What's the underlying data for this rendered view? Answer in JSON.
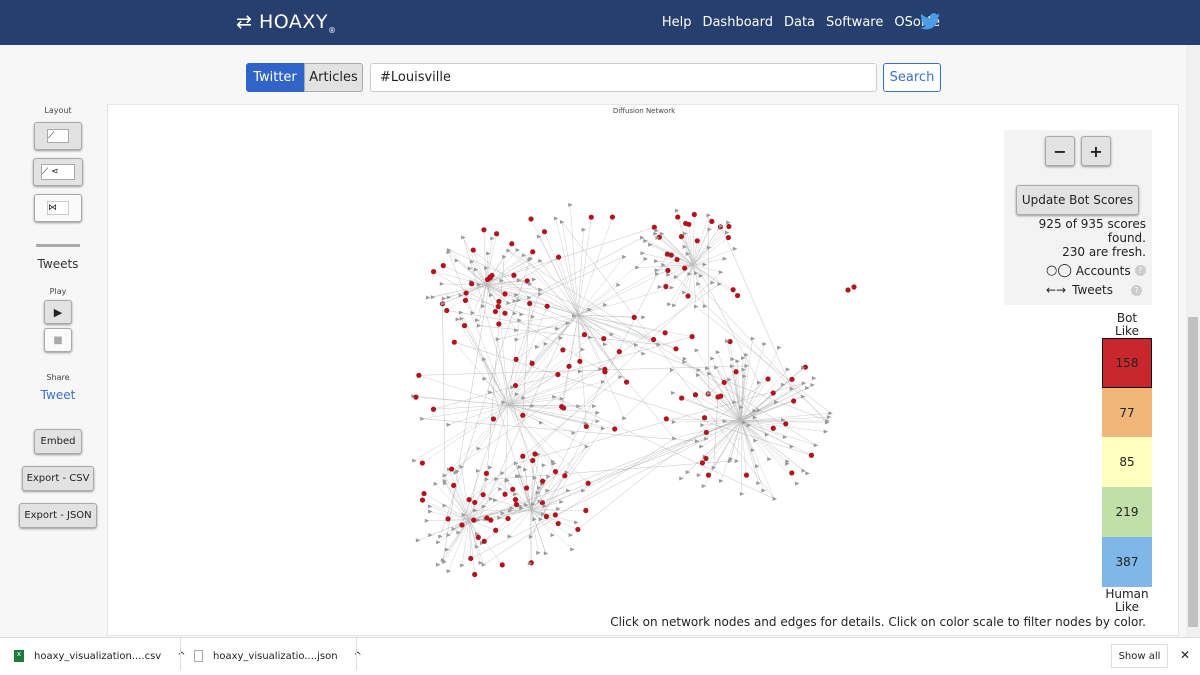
{
  "header": {
    "logo": "HOAXY",
    "logo_mark": "®",
    "nav": [
      "Help",
      "Dashboard",
      "Data",
      "Software",
      "OSoMe"
    ],
    "twitter_icon": "twitter-bird-icon"
  },
  "search": {
    "tabs": [
      {
        "label": "Twitter",
        "active": true
      },
      {
        "label": "Articles",
        "active": false
      }
    ],
    "query": "#Louisville",
    "button": "Search"
  },
  "sidebar": {
    "layout_label": "Layout",
    "layout_icons": [
      "timeline-icon",
      "timeline-network-icon",
      "network-icon"
    ],
    "tweets_label": "Tweets",
    "play_label": "Play",
    "share_label": "Share",
    "tweet_link": "Tweet",
    "embed": "Embed",
    "export_csv": "Export - CSV",
    "export_json": "Export - JSON"
  },
  "graph": {
    "title": "Diffusion Network",
    "zoom_out": "−",
    "zoom_in": "+",
    "update_button": "Update Bot Scores",
    "scores_found": "925 of 935 scores found.",
    "fresh": "230 are fresh.",
    "legend_accounts": "Accounts",
    "legend_tweets": "Tweets",
    "footer": "Click on network nodes and edges for details. Click on color scale to filter nodes by color."
  },
  "color_scale": {
    "top_label": [
      "Bot",
      "Like"
    ],
    "bottom_label": [
      "Human",
      "Like"
    ],
    "bins": [
      {
        "count": "158",
        "color": "#c8282d"
      },
      {
        "count": "77",
        "color": "#f0b67a"
      },
      {
        "count": "85",
        "color": "#ffffc0"
      },
      {
        "count": "219",
        "color": "#bfe0a8"
      },
      {
        "count": "387",
        "color": "#7fb7e8"
      }
    ]
  },
  "downloads": {
    "items": [
      {
        "name": "hoaxy_visualization....csv",
        "icon": "excel-file-icon"
      },
      {
        "name": "hoaxy_visualizatio....json",
        "icon": "file-icon"
      }
    ],
    "show_all": "Show all"
  },
  "colors": {
    "header": "#263f6e",
    "accent": "#3a6fd0",
    "bot_node": "#b3141b"
  }
}
